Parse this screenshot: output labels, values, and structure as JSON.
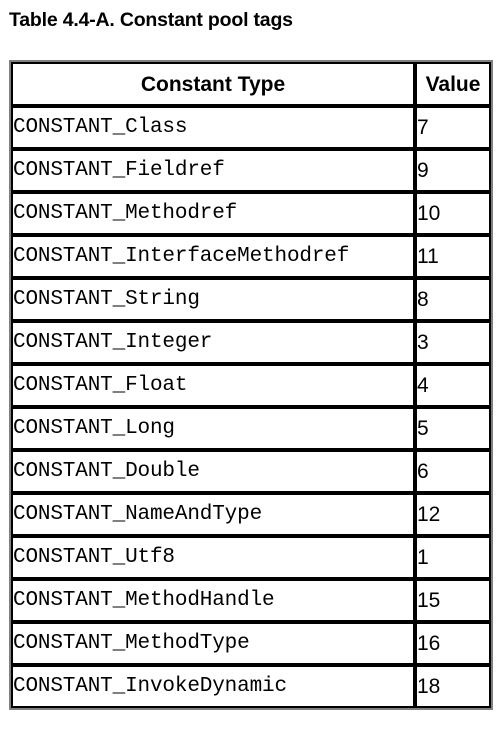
{
  "caption": "Table 4.4-A. Constant pool tags",
  "table": {
    "columns": [
      {
        "key": "constant_type",
        "label": "Constant Type"
      },
      {
        "key": "value",
        "label": "Value"
      }
    ],
    "rows": [
      {
        "constant_type": "CONSTANT_Class",
        "value": "7"
      },
      {
        "constant_type": "CONSTANT_Fieldref",
        "value": "9"
      },
      {
        "constant_type": "CONSTANT_Methodref",
        "value": "10"
      },
      {
        "constant_type": "CONSTANT_InterfaceMethodref",
        "value": "11"
      },
      {
        "constant_type": "CONSTANT_String",
        "value": "8"
      },
      {
        "constant_type": "CONSTANT_Integer",
        "value": "3"
      },
      {
        "constant_type": "CONSTANT_Float",
        "value": "4"
      },
      {
        "constant_type": "CONSTANT_Long",
        "value": "5"
      },
      {
        "constant_type": "CONSTANT_Double",
        "value": "6"
      },
      {
        "constant_type": "CONSTANT_NameAndType",
        "value": "12"
      },
      {
        "constant_type": "CONSTANT_Utf8",
        "value": "1"
      },
      {
        "constant_type": "CONSTANT_MethodHandle",
        "value": "15"
      },
      {
        "constant_type": "CONSTANT_MethodType",
        "value": "16"
      },
      {
        "constant_type": "CONSTANT_InvokeDynamic",
        "value": "18"
      }
    ]
  },
  "colors": {
    "text": "#000000",
    "background": "#ffffff",
    "cell_border": "#000000",
    "table_border": "#808080"
  }
}
